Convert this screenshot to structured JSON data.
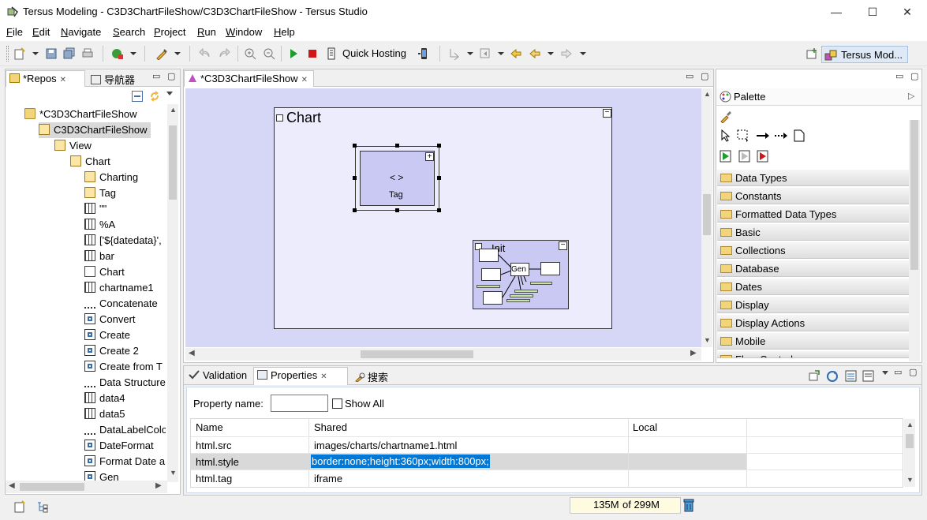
{
  "window": {
    "title": "Tersus Modeling - C3D3ChartFileShow/C3D3ChartFileShow - Tersus Studio",
    "minimize": "—",
    "maximize": "☐",
    "close": "✕"
  },
  "menu": [
    "File",
    "Edit",
    "Navigate",
    "Search",
    "Project",
    "Run",
    "Window",
    "Help"
  ],
  "toolbar": {
    "quick_hosting": "Quick Hosting",
    "perspective": "Tersus Mod..."
  },
  "left_panel": {
    "tabs": [
      {
        "label": "*Repos"
      },
      {
        "label": "导航器"
      }
    ],
    "tree": [
      {
        "label": "*C3D3ChartFileShow",
        "icon": "folder",
        "indent": 0
      },
      {
        "label": "C3D3ChartFileShow",
        "icon": "cube",
        "indent": 1,
        "selected": true
      },
      {
        "label": "View",
        "icon": "cube",
        "indent": 2
      },
      {
        "label": "Chart",
        "icon": "cube",
        "indent": 3
      },
      {
        "label": "Charting",
        "icon": "cube",
        "indent": 4
      },
      {
        "label": "Tag",
        "icon": "cube",
        "indent": 4
      },
      {
        "label": "\"\"",
        "icon": "grid",
        "indent": 4
      },
      {
        "label": "%A",
        "icon": "grid",
        "indent": 4
      },
      {
        "label": "['${datedata}',",
        "icon": "grid",
        "indent": 4
      },
      {
        "label": "bar",
        "icon": "grid",
        "indent": 4
      },
      {
        "label": "Chart",
        "icon": "box",
        "indent": 4
      },
      {
        "label": "chartname1",
        "icon": "grid",
        "indent": 4
      },
      {
        "label": "Concatenate",
        "icon": "dots",
        "indent": 4
      },
      {
        "label": "Convert",
        "icon": "flow",
        "indent": 4
      },
      {
        "label": "Create",
        "icon": "flow",
        "indent": 4
      },
      {
        "label": "Create 2",
        "icon": "flow",
        "indent": 4
      },
      {
        "label": "Create from T",
        "icon": "flow",
        "indent": 4
      },
      {
        "label": "Data Structure",
        "icon": "dots",
        "indent": 4
      },
      {
        "label": "data4",
        "icon": "grid",
        "indent": 4
      },
      {
        "label": "data5",
        "icon": "grid",
        "indent": 4
      },
      {
        "label": "DataLabelColo",
        "icon": "dots",
        "indent": 4
      },
      {
        "label": "DateFormat",
        "icon": "flow",
        "indent": 4
      },
      {
        "label": "Format Date a",
        "icon": "flow",
        "indent": 4
      },
      {
        "label": "Gen",
        "icon": "flow",
        "indent": 4
      }
    ]
  },
  "editor": {
    "tab": "*C3D3ChartFileShow",
    "chart_box_title": "Chart",
    "tag_symbol": "< >",
    "tag_label": "Tag",
    "init_label": "Init",
    "gen_label": "Gen",
    "collapse_symbol": "−",
    "expand_symbol": "+"
  },
  "palette": {
    "title": "Palette",
    "groups": [
      "Data Types",
      "Constants",
      "Formatted Data Types",
      "Basic",
      "Collections",
      "Database",
      "Dates",
      "Display",
      "Display Actions",
      "Mobile",
      "Flow Control"
    ]
  },
  "bottom": {
    "tabs": [
      {
        "label": "Validation"
      },
      {
        "label": "Properties"
      },
      {
        "label": "搜索"
      }
    ],
    "property_name_label": "Property name:",
    "property_name_value": "",
    "show_all_label": "Show All",
    "columns": [
      "Name",
      "Shared",
      "Local"
    ],
    "rows": [
      {
        "name": "html.src",
        "shared": "images/charts/chartname1.html",
        "local": ""
      },
      {
        "name": "html.style",
        "shared": "border:none;height:360px;width:800px;",
        "local": "",
        "selected": true
      },
      {
        "name": "html.tag",
        "shared": "iframe",
        "local": ""
      }
    ]
  },
  "status": {
    "memory_used": "135M",
    "memory_total": "of 299M"
  },
  "colors": {
    "canvas": "#d6d6f7",
    "selection": "#0078d7",
    "diagram_box": "#c9c9f3"
  }
}
